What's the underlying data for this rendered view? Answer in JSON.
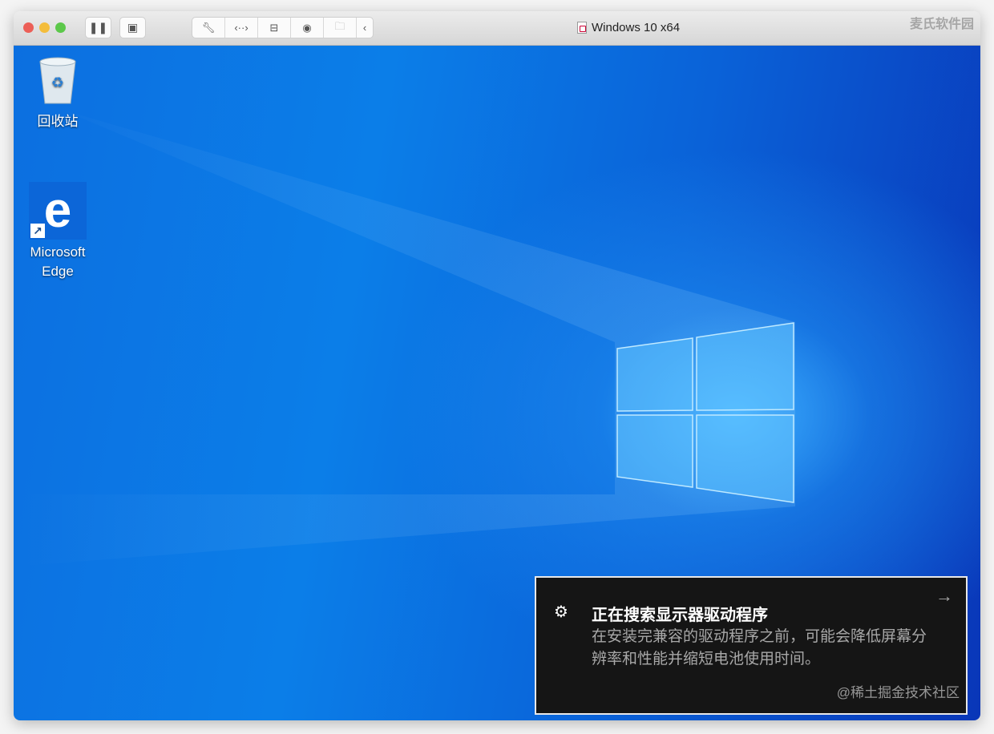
{
  "window": {
    "title": "Windows 10 x64",
    "colors": {
      "close": "#ec5f57",
      "minimize": "#f4bd3b",
      "zoom": "#5cc84a"
    }
  },
  "toolbar": {
    "buttons": [
      "pause-icon",
      "snapshot-icon"
    ],
    "group": [
      "wrench-icon",
      "code-arrows-icon",
      "disk-icon",
      "camera-icon",
      "shared-folder-icon",
      "chevron-left-icon"
    ]
  },
  "desktop": {
    "icons": [
      {
        "label": "回收站"
      },
      {
        "label": "Microsoft Edge"
      }
    ]
  },
  "notification": {
    "title": "正在搜索显示器驱动程序",
    "body": "在安装完兼容的驱动程序之前，可能会降低屏幕分辨率和性能并缩短电池使用时间。"
  },
  "watermarks": {
    "bottom": "@稀土掘金技术社区",
    "top": "麦氏软件园"
  }
}
